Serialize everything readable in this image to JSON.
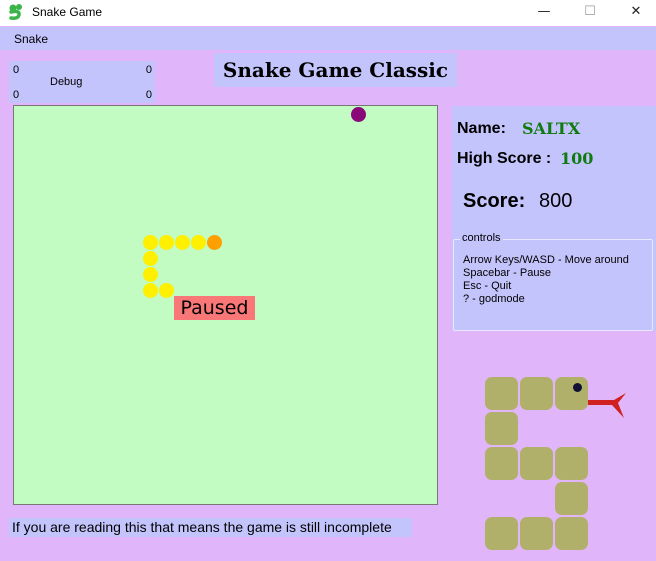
{
  "window": {
    "title": "Snake Game",
    "icon": "snake-app-icon",
    "controls": {
      "minimize": "—",
      "maximize": "☐",
      "close": "✕"
    }
  },
  "menu": {
    "items": [
      "Snake"
    ]
  },
  "debug": {
    "top_left": "0",
    "top_right": "0",
    "label": "Debug",
    "bottom_left": "0",
    "bottom_right": "0"
  },
  "header": {
    "title": "Snake Game Classic"
  },
  "board": {
    "status": "Paused",
    "colors": {
      "background": "#c2fcc2",
      "snake_body": "#ffef00",
      "snake_head": "#ff9f00",
      "food": "#8a087a"
    }
  },
  "info": {
    "name_label": "Name:",
    "name_value": "SALTX",
    "high_score_label": "High Score :",
    "high_score_value": "100",
    "score_label": "Score:",
    "score_value": "800"
  },
  "controls": {
    "title": "controls",
    "lines": [
      "Arrow Keys/WASD - Move around",
      "Spacebar - Pause",
      "Esc - Quit",
      "? - godmode"
    ]
  },
  "footer": {
    "message": "If you are reading this that means the game is still incomplete"
  },
  "colors": {
    "accent_panel": "#c4c4fd",
    "page_bg": "#e1b5f9",
    "name_green": "#107a10"
  }
}
